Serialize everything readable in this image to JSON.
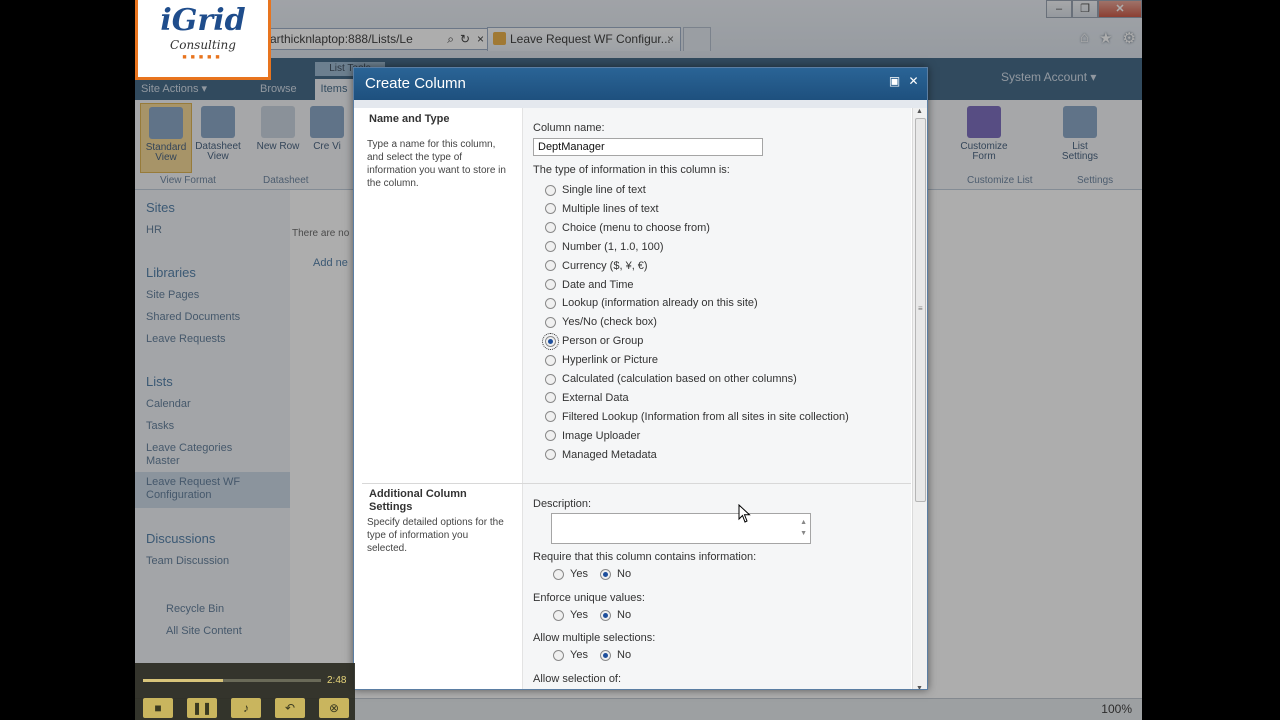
{
  "logo": {
    "brand": "iGrid",
    "sub": "Consulting"
  },
  "browser": {
    "address": "arthicknlaptop:888/Lists/Le",
    "tab_title": "Leave Request WF Configur...",
    "tab_close": "×",
    "zoom": "100%"
  },
  "sharepoint": {
    "site_actions": "Site Actions ▾",
    "browse": "Browse",
    "items": "Items",
    "list_tools": "List Tools",
    "system_account": "System Account ▾",
    "ribbon": {
      "standard_view": "Standard View",
      "datasheet_view": "Datasheet View",
      "new_row": "New Row",
      "create": "Cre Vi",
      "view_format": "View Format",
      "datasheet": "Datasheet",
      "customize_form": "Customize Form",
      "list_settings": "List Settings",
      "customize_list": "Customize List",
      "settings": "Settings"
    },
    "nav": {
      "sites": "Sites",
      "hr": "HR",
      "libraries": "Libraries",
      "site_pages": "Site Pages",
      "shared_documents": "Shared Documents",
      "leave_requests": "Leave Requests",
      "lists": "Lists",
      "calendar": "Calendar",
      "tasks": "Tasks",
      "leave_categories": "Leave Categories Master",
      "leave_request_wf": "Leave Request WF Configuration",
      "discussions": "Discussions",
      "team_discussion": "Team Discussion",
      "recycle_bin": "Recycle Bin",
      "all_site_content": "All Site Content"
    },
    "content": {
      "empty": "There are no",
      "add_new": "Add ne"
    }
  },
  "dialog": {
    "title": "Create Column",
    "maximize": "▣",
    "close": "✕",
    "name_type": {
      "title": "Name and Type",
      "desc": "Type a name for this column, and select the type of information you want to store in the column.",
      "column_name_label": "Column name:",
      "column_name_value": "DeptManager",
      "type_label": "The type of information in this column is:",
      "options": [
        "Single line of text",
        "Multiple lines of text",
        "Choice (menu to choose from)",
        "Number (1, 1.0, 100)",
        "Currency ($, ¥, €)",
        "Date and Time",
        "Lookup (information already on this site)",
        "Yes/No (check box)",
        "Person or Group",
        "Hyperlink or Picture",
        "Calculated (calculation based on other columns)",
        "External Data",
        "Filtered Lookup (Information from all sites in site collection)",
        "Image Uploader",
        "Managed Metadata"
      ],
      "selected": "Person or Group"
    },
    "additional": {
      "title": "Additional Column Settings",
      "desc": "Specify detailed options for the type of information you selected.",
      "description_label": "Description:",
      "require_label": "Require that this column contains information:",
      "unique_label": "Enforce unique values:",
      "multiple_label": "Allow multiple selections:",
      "selection_label": "Allow selection of:",
      "yes": "Yes",
      "no": "No"
    }
  },
  "player": {
    "time": "2:48",
    "progress": 0.45
  }
}
